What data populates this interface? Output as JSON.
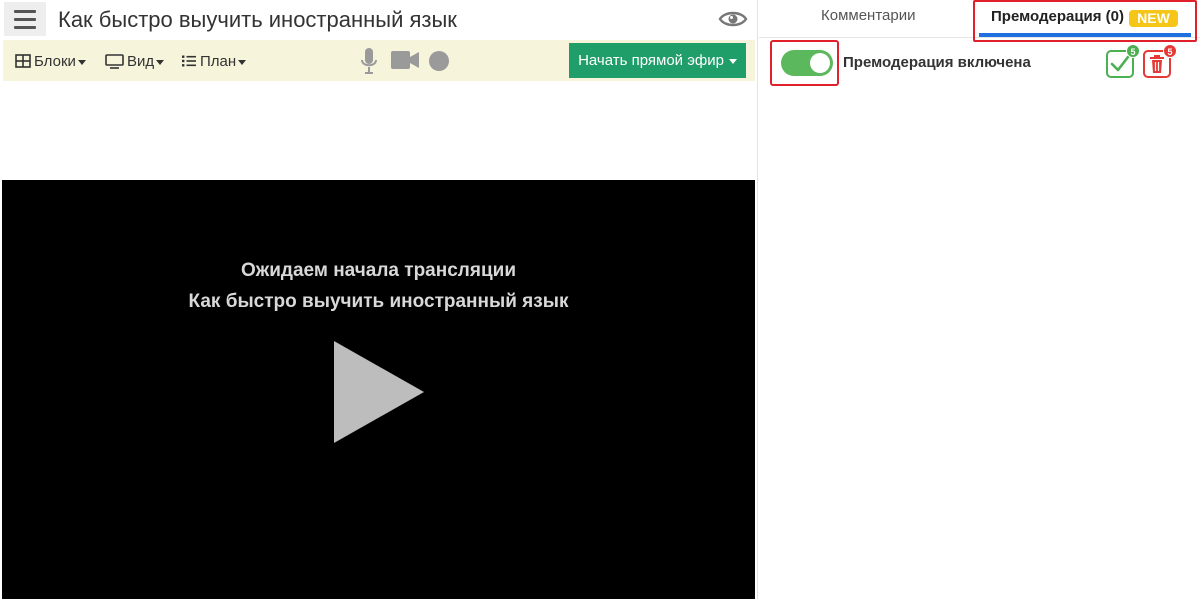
{
  "header": {
    "title": "Как быстро выучить иностранный язык"
  },
  "toolbar": {
    "blocks_label": "Блоки",
    "view_label": "Вид",
    "plan_label": "План",
    "live_button_label": "Начать прямой эфир"
  },
  "player": {
    "waiting_text": "Ожидаем начала трансляции",
    "stream_title": "Как быстро выучить иностранный язык"
  },
  "sidebar": {
    "tabs": [
      {
        "label": "Комментарии",
        "active": false
      },
      {
        "label": "Премодерация (0)",
        "active": true,
        "badge": "NEW"
      }
    ],
    "premoderation": {
      "toggle_label": "Премодерация включена",
      "enabled": true,
      "approve_count": "5",
      "delete_count": "5"
    }
  },
  "colors": {
    "toolbar_bg": "#f6f5dc",
    "live_button": "#1f9e6a",
    "toggle_on": "#5cb85c",
    "tab_underline": "#1f6fe0",
    "badge_new": "#f5c518",
    "highlight_frame": "#e0202a"
  },
  "icons": {
    "menu": "hamburger-icon",
    "eye": "eye-icon",
    "blocks": "grid-icon",
    "view": "monitor-icon",
    "plan": "list-icon",
    "mic": "microphone-icon",
    "camera": "video-camera-icon",
    "record": "record-icon",
    "play": "play-icon",
    "approve": "check-icon",
    "delete": "trash-icon"
  }
}
